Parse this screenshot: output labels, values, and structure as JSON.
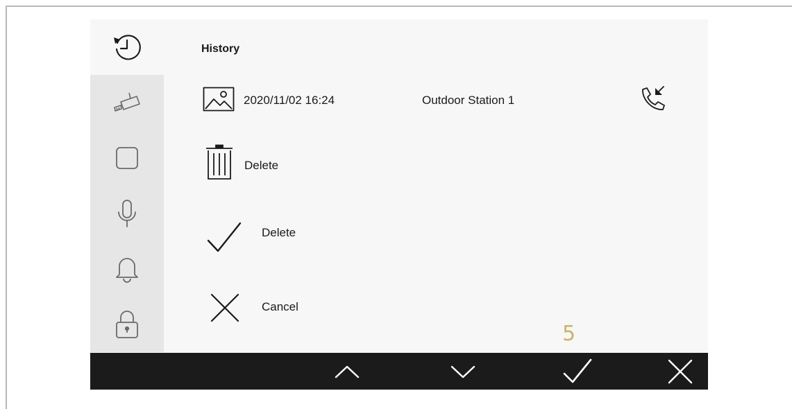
{
  "header": {
    "title": "History"
  },
  "sidebar": {
    "items": [
      {
        "icon": "history-icon",
        "active": true
      },
      {
        "icon": "camera-icon",
        "active": false
      },
      {
        "icon": "square-icon",
        "active": false
      },
      {
        "icon": "microphone-icon",
        "active": false
      },
      {
        "icon": "bell-icon",
        "active": false
      },
      {
        "icon": "lock-icon",
        "active": false
      }
    ]
  },
  "record": {
    "thumbnail_icon": "image-icon",
    "datetime": "2020/11/02 16:24",
    "source": "Outdoor Station 1",
    "call_icon": "incoming-call-icon"
  },
  "actions": {
    "delete_label": "Delete",
    "delete_icon": "trash-icon",
    "confirm_label": "Delete",
    "confirm_icon": "check-icon",
    "cancel_label": "Cancel",
    "cancel_icon": "close-icon"
  },
  "counter": "5",
  "bottom_bar": {
    "buttons": [
      "up-arrow-icon",
      "down-arrow-icon",
      "check-icon",
      "close-icon"
    ]
  },
  "colors": {
    "accent_counter": "#c9b46b",
    "bottom_bar": "#1b1b1b",
    "panel": "#f7f7f7",
    "sidebar_inactive": "#e6e6e6"
  }
}
